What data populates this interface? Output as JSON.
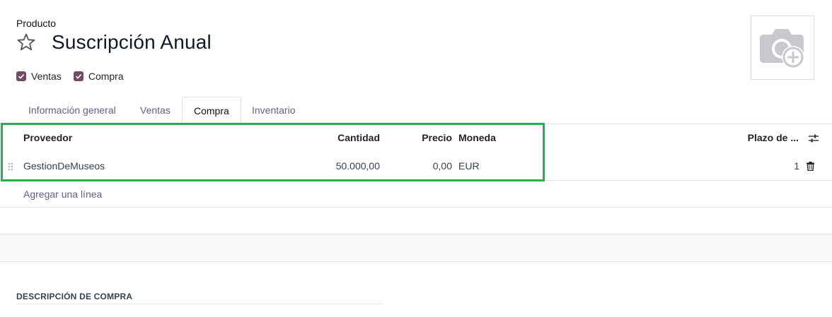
{
  "product": {
    "label": "Producto",
    "title": "Suscripción Anual",
    "favorite_icon": "star-outline-icon",
    "image_icon": "camera-add-icon"
  },
  "checkboxes": [
    {
      "label": "Ventas",
      "checked": true
    },
    {
      "label": "Compra",
      "checked": true
    }
  ],
  "tabs": [
    {
      "label": "Información general",
      "active": false
    },
    {
      "label": "Ventas",
      "active": false
    },
    {
      "label": "Compra",
      "active": true
    },
    {
      "label": "Inventario",
      "active": false
    }
  ],
  "vendor_table": {
    "columns": {
      "vendor": "Proveedor",
      "quantity": "Cantidad",
      "price": "Precio",
      "currency": "Moneda",
      "lead_time": "Plazo de ..."
    },
    "rows": [
      {
        "vendor": "GestionDeMuseos",
        "quantity": "50.000,00",
        "price": "0,00",
        "currency": "EUR",
        "lead_time": "1"
      }
    ],
    "add_line": "Agregar una línea"
  },
  "purchase_description": {
    "title": "DESCRIPCIÓN DE COMPRA"
  },
  "colors": {
    "accent": "#714b67",
    "highlight": "#22b14c",
    "link": "#5f5f8a"
  }
}
